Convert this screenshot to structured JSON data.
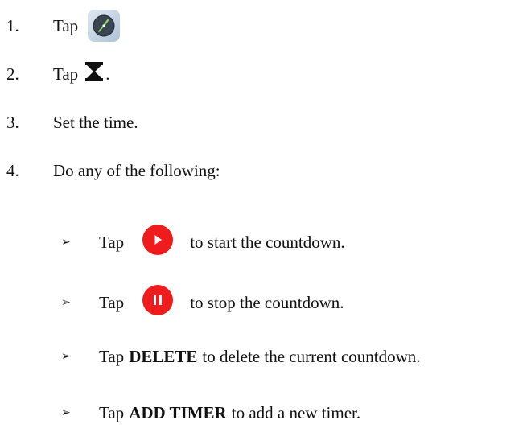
{
  "steps": [
    {
      "num": "1.",
      "text": "Tap"
    },
    {
      "num": "2.",
      "text": "Tap",
      "after": "."
    },
    {
      "num": "3.",
      "text": "Set the time."
    },
    {
      "num": "4.",
      "text": "Do any of the following:"
    }
  ],
  "bullet_glyph": "➢",
  "sub_items": [
    {
      "tap": "Tap",
      "rest": "to start the countdown."
    },
    {
      "tap": "Tap",
      "rest": "to stop the countdown."
    },
    {
      "tap": "Tap",
      "bold": "DELETE",
      "rest": "to delete the current countdown."
    },
    {
      "tap": "Tap",
      "bold": "ADD TIMER",
      "rest": "to add a new timer."
    }
  ],
  "icons": {
    "clock_app": "clock-app-icon",
    "timer_tab": "hourglass-icon",
    "start": "play-icon",
    "stop": "pause-icon"
  },
  "colors": {
    "text": "#111111",
    "red_button": "#ee1c1c",
    "clock_face": "#3a4452",
    "clock_hand": "#8be04e"
  }
}
